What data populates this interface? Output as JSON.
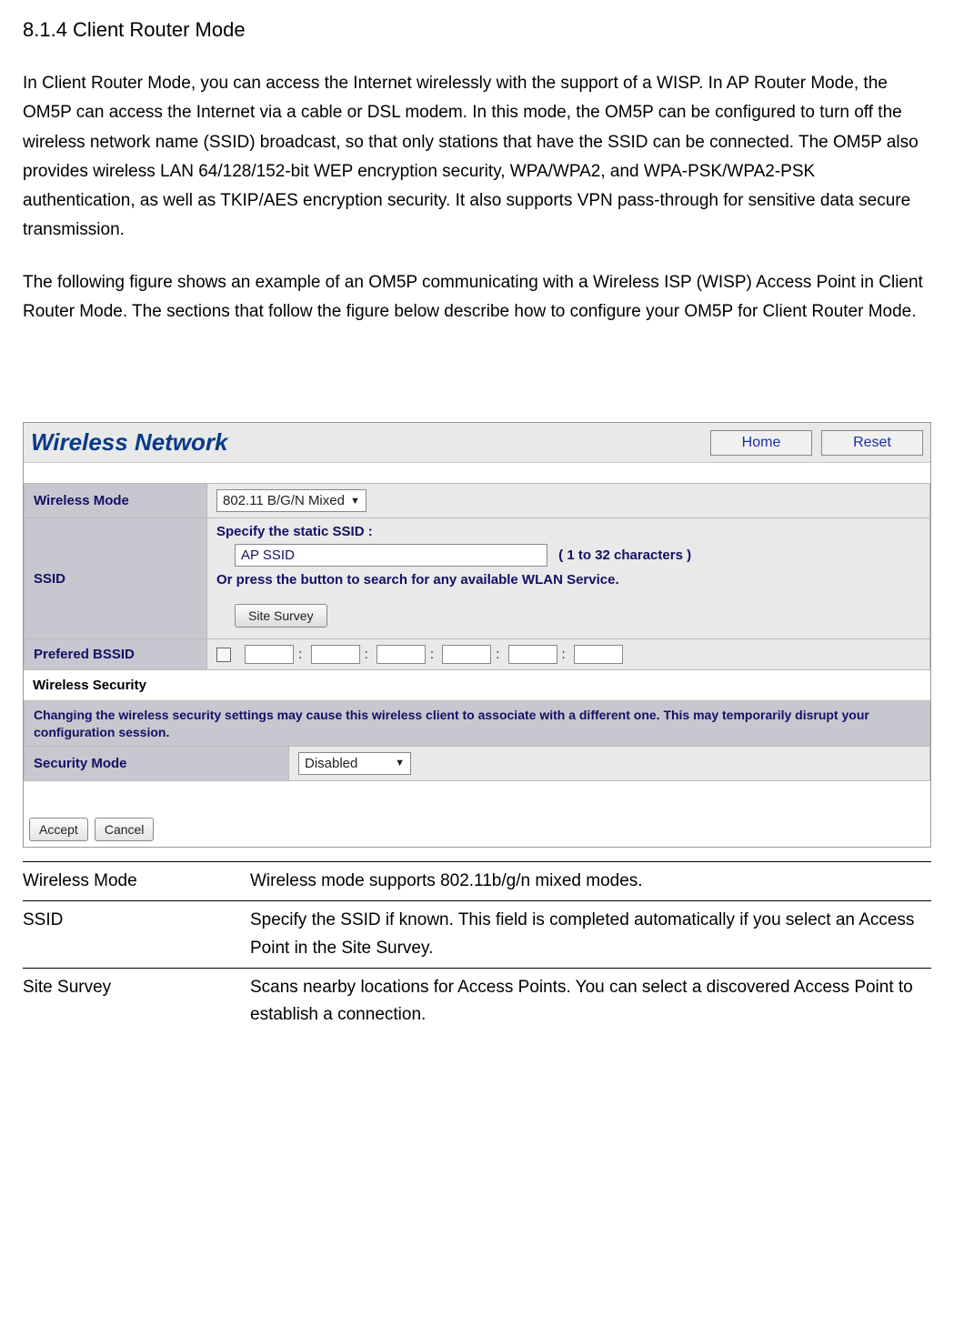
{
  "heading": "8.1.4 Client Router Mode",
  "paragraph1": "In Client Router Mode, you can access the Internet wirelessly with the support of a WISP. In AP Router Mode, the OM5P can access the Internet via a cable or DSL modem. In this mode, the OM5P can be configured to turn off the wireless network name (SSID) broadcast, so that only stations that have the SSID can be connected. The OM5P also provides wireless LAN 64/128/152-bit WEP encryption security, WPA/WPA2, and WPA-PSK/WPA2-PSK authentication, as well as TKIP/AES encryption security. It also supports VPN pass-through for sensitive data secure transmission.",
  "paragraph2": "The following figure shows an example of an OM5P communicating with a Wireless  ISP (WISP) Access Point in Client Router Mode. The sections that follow the figure below describe how to configure your OM5P for Client Router Mode.",
  "router": {
    "title": "Wireless Network",
    "home": "Home",
    "reset": "Reset",
    "wireless_mode_label": "Wireless Mode",
    "wireless_mode_value": "802.11 B/G/N Mixed",
    "ssid_label": "SSID",
    "ssid_line1": "Specify the static SSID  :",
    "ssid_value": "AP SSID",
    "ssid_hint": "( 1 to 32 characters )",
    "ssid_line2": "Or press the button to search for any available WLAN Service.",
    "site_survey": "Site Survey",
    "bssid_label": "Prefered BSSID",
    "security_section": "Wireless Security",
    "warning": "Changing the wireless security settings may cause this wireless client to associate with a different one. This may temporarily disrupt your configuration session.",
    "security_mode_label": "Security Mode",
    "security_mode_value": "Disabled",
    "accept": "Accept",
    "cancel": "Cancel"
  },
  "desc": {
    "wireless_mode_term": "Wireless Mode",
    "wireless_mode_def": "Wireless mode supports 802.11b/g/n mixed modes.",
    "ssid_term": "SSID",
    "ssid_def": "Specify the SSID if known. This field is completed automatically if you select an Access Point in the Site Survey.",
    "survey_term": "Site Survey",
    "survey_def": "Scans nearby locations for Access Points. You can select a discovered Access Point to establish a connection."
  }
}
